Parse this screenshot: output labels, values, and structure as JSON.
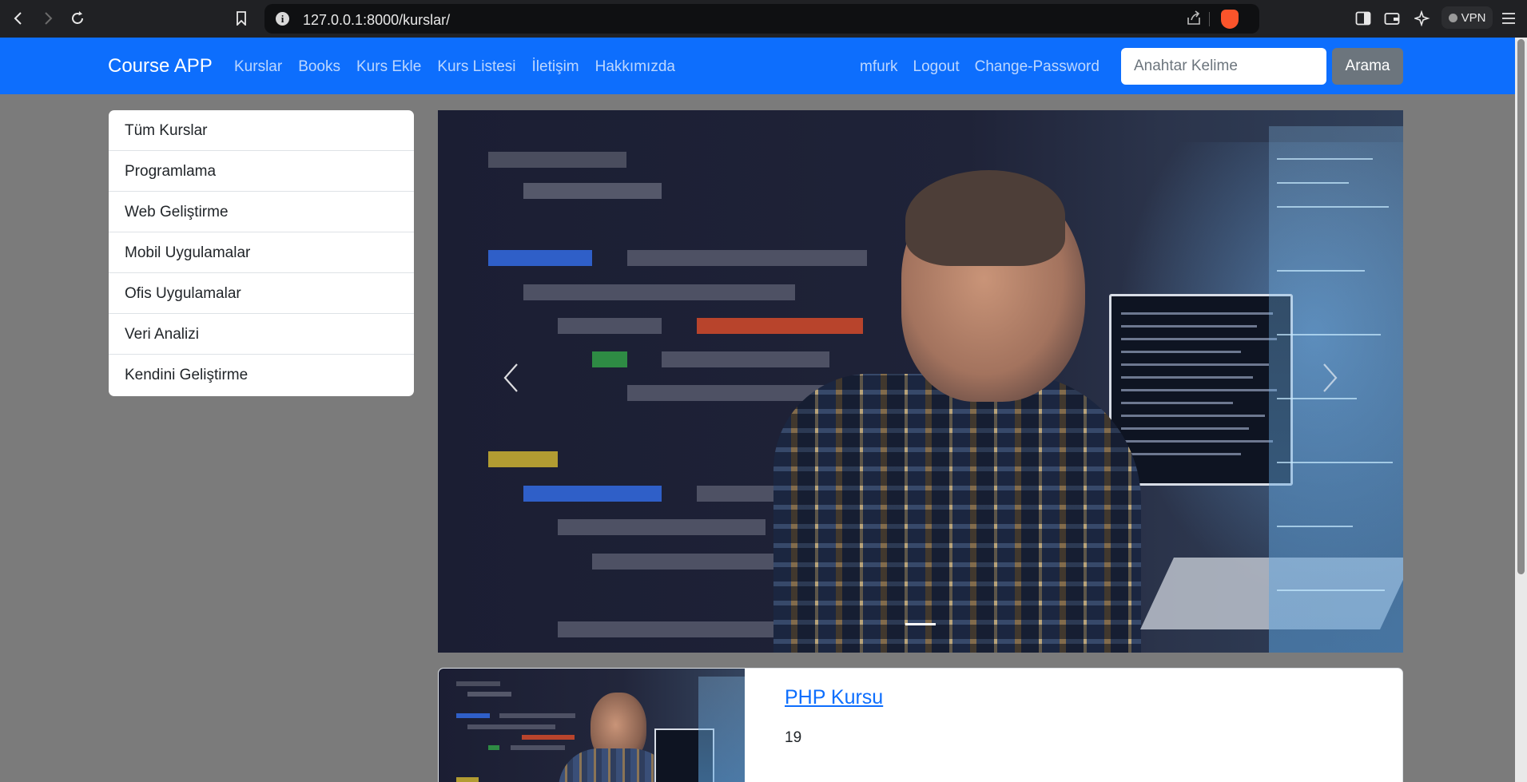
{
  "browser": {
    "url": "127.0.0.1:8000/kurslar/",
    "vpn_label": "VPN"
  },
  "navbar": {
    "brand": "Course APP",
    "links": [
      "Kurslar",
      "Books",
      "Kurs Ekle",
      "Kurs Listesi",
      "İletişim",
      "Hakkımızda"
    ],
    "user_links": [
      "mfurk",
      "Logout",
      "Change-Password"
    ],
    "search_placeholder": "Anahtar Kelime",
    "search_button": "Arama",
    "color": "#0d6efd"
  },
  "sidebar": {
    "items": [
      "Tüm Kurslar",
      "Programlama",
      "Web Geliştirme",
      "Mobil Uygulamalar",
      "Ofis Uygulamalar",
      "Veri Analizi",
      "Kendini Geliştirme"
    ]
  },
  "carousel": {
    "prev_icon": "chevron-left-icon",
    "next_icon": "chevron-right-icon",
    "active_slide": 1,
    "slide_count": 1
  },
  "courses": [
    {
      "title": "PHP Kursu",
      "count": "19"
    }
  ]
}
